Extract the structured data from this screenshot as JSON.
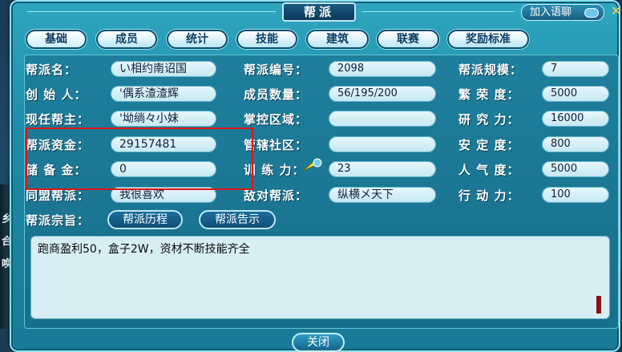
{
  "window": {
    "title": "帮派",
    "chat_label": "加入语聊",
    "close_symbol": "✕"
  },
  "tabs": [
    "基础",
    "成员",
    "统计",
    "技能",
    "建筑",
    "联赛",
    "奖励标准"
  ],
  "info": {
    "col1": [
      {
        "label": "帮派名：",
        "value": "い相约南诏国"
      },
      {
        "label": "创 始 人：",
        "value": "'偶系渣渣辉"
      },
      {
        "label": "现任帮主：",
        "value": "'坳绱々小妹"
      },
      {
        "label": "帮派资金：",
        "value": "29157481"
      },
      {
        "label": "储 备 金：",
        "value": "0"
      },
      {
        "label": "同盟帮派：",
        "value": "我很喜欢"
      }
    ],
    "col2": [
      {
        "label": "帮派编号：",
        "value": "2098"
      },
      {
        "label": "成员数量：",
        "value": "56/195/200"
      },
      {
        "label": "掌控区域：",
        "value": ""
      },
      {
        "label": "管辖社区：",
        "value": ""
      },
      {
        "label": "训 练 力：",
        "value": "23"
      },
      {
        "label": "敌对帮派：",
        "value": "纵横メ天下"
      }
    ],
    "col3": [
      {
        "label": "帮派规模：",
        "value": "7"
      },
      {
        "label": "繁 荣 度：",
        "value": "5000"
      },
      {
        "label": "研 究 力：",
        "value": "16000"
      },
      {
        "label": "安 定 度：",
        "value": "800"
      },
      {
        "label": "人 气 度：",
        "value": "5000"
      },
      {
        "label": "行 动 力：",
        "value": "100"
      }
    ]
  },
  "purpose": {
    "label": "帮派宗旨：",
    "history_tab": "帮派历程",
    "notice_tab": "帮派告示",
    "text": "跑商盈利50，盒子2W，资材不断技能齐全"
  },
  "footer": {
    "close_label": "关闭"
  },
  "edge": {
    "glyphs": [
      "乡",
      "合",
      "唤"
    ]
  },
  "colors": {
    "accent": "#1d8aa6",
    "highlight": "#e01515",
    "tab_text": "#0b3f66"
  }
}
